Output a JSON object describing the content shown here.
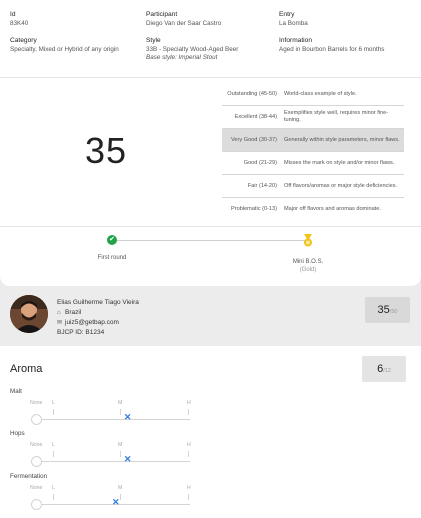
{
  "entry_info": {
    "id": {
      "label": "Id",
      "value": "83K40"
    },
    "participant": {
      "label": "Participant",
      "value": "Diego Van der Saar Castro"
    },
    "entry": {
      "label": "Entry",
      "value": "La Bomba"
    },
    "category": {
      "label": "Category",
      "value": "Specialty, Mixed or Hybrid of any origin"
    },
    "style": {
      "label": "Style",
      "value": "33B - Specialty Wood-Aged Beer",
      "base": "Base style: Imperial Stout"
    },
    "information": {
      "label": "Information",
      "value": "Aged in Bourbon Barrels for 6 months"
    }
  },
  "score": "35",
  "scale": [
    {
      "range": "Outstanding (45-50)",
      "desc": "World-class example of style.",
      "active": false
    },
    {
      "range": "Excellent (38-44)",
      "desc": "Exemplifies style well, requires minor fine-tuning.",
      "active": false
    },
    {
      "range": "Very Good (30-37)",
      "desc": "Generally within style parameters, minor flaws.",
      "active": true
    },
    {
      "range": "Good (21-29)",
      "desc": "Misses the mark on style and/or minor flaws.",
      "active": false
    },
    {
      "range": "Fair (14-20)",
      "desc": "Off flavors/aromas or major style deficiencies.",
      "active": false
    },
    {
      "range": "Problematic (0-13)",
      "desc": "Major off flavors and aromas dominate.",
      "active": false
    }
  ],
  "timeline": {
    "first_round": "First round",
    "mini_bos": "Mini B.O.S.",
    "mini_bos_sub": "(Gold)"
  },
  "judge": {
    "name": "Elias Guilherme Tiago Vieira",
    "country": "Brazil",
    "email": "juiz5@getbap.com",
    "bjcp": "BJCP ID: B1234",
    "score": "35",
    "score_max": "/50"
  },
  "aroma": {
    "title": "Aroma",
    "score": "6",
    "score_max": "/12",
    "scale_labels": {
      "none": "None",
      "low": "L",
      "mid": "M",
      "high": "H"
    },
    "categories": [
      {
        "label": "Malt",
        "level": 0.58
      },
      {
        "label": "Hops",
        "level": 0.58
      },
      {
        "label": "Fermentation",
        "level": 0.5
      }
    ]
  },
  "colors": {
    "check": "#22a34a",
    "medal": "#f0c419",
    "marker": "#2d7be0",
    "active_row": "#dcdcdc"
  }
}
